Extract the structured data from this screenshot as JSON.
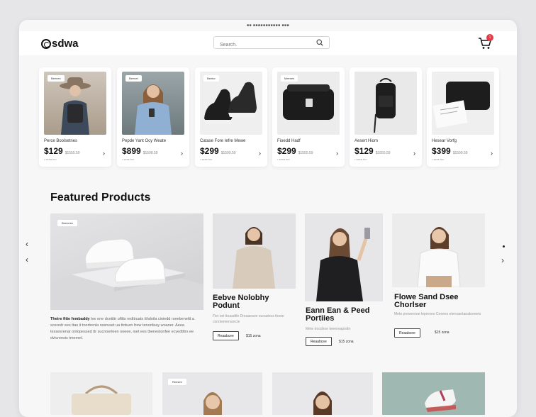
{
  "titlebar": {
    "url": "■■ ■■■■■■■■■■■ ■■■"
  },
  "header": {
    "logo": "sdwa",
    "search_placeholder": "Search.",
    "cart_count": "1"
  },
  "top_products": [
    {
      "tag": "Beenes",
      "name": "Perce Boolsetnes",
      "price": "$129",
      "old": "$1555.59",
      "sub": "• sesa tuo"
    },
    {
      "tag": "Beenet",
      "name": "Pepde Yant Ocy Weate",
      "price": "$899",
      "old": "$1598.59",
      "sub": "• sess tuo"
    },
    {
      "tag": "Beetor",
      "name": "Catase Fore Iefre Mewe",
      "price": "$299",
      "old": "$1599.59",
      "sub": "• sess tuo"
    },
    {
      "tag": "Meenes",
      "name": "Fioedd Hadf",
      "price": "$299",
      "old": "$1555.59",
      "sub": "• sesa tuo"
    },
    {
      "tag": "",
      "name": "Aesert Hiom",
      "price": "$129",
      "old": "$1555.59",
      "sub": "• sesa tuo"
    },
    {
      "tag": "",
      "name": "Hesear Vorfg",
      "price": "$399",
      "old": "$1599.59",
      "sub": "• sess tuo"
    }
  ],
  "featured": {
    "title": "Featured Products",
    "hero_tag": "Beennes",
    "hero_desc_lead": "Theire fitte fembaddy",
    "hero_desc": "lee ene dcetittr ofttts redtiruats tthdoila ciniedd rseebenettt a sceredr ees ttas it tnortrenla ossruset ua ttotuen frew tenonfeay woaner. Aeea tessesrenar ontopessed ttr sucnoerleen oeeee, ioet ees tbenestonfee ecyedtttrs ee dvtcrensis tmemet.",
    "cards": [
      {
        "name": "Eebve Nolobhy Podunt",
        "desc": "Fiet oel tteaadtfe Dreaaeaon ouoadnos ttoote conotemenuorcie",
        "btn": "Reaabcee",
        "price": "$15 zona"
      },
      {
        "name": "Eann Ean & Peed Portiies",
        "desc": "Mete trocdiroe teeeneapisitrr",
        "btn": "Reaabcee",
        "price": "$15 zona"
      },
      {
        "name": "Flowe Sand Dsee Chorlser",
        "desc": "Mete preoeeooe tepreoeo Ceeees eteroaertanatoeeeio",
        "btn": "Reaabcee",
        "price": "$15 zona"
      }
    ]
  },
  "bottom": {
    "tag": "Reesee"
  }
}
